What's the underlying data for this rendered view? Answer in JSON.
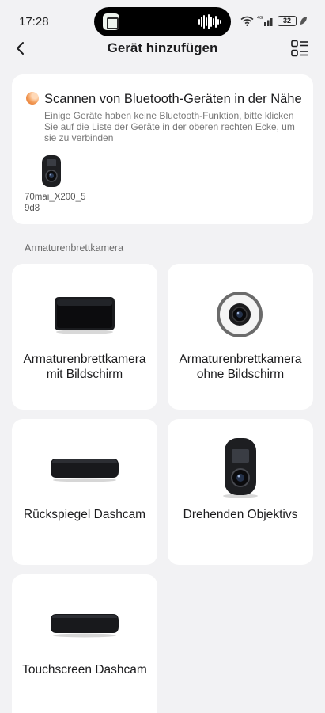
{
  "status_bar": {
    "time": "17:28",
    "battery": "32",
    "network": "4G"
  },
  "header": {
    "title": "Gerät hinzufügen"
  },
  "scan": {
    "title": "Scannen von Bluetooth-Geräten in der Nähe",
    "description": "Einige Geräte haben keine Bluetooth-Funktion, bitte klicken Sie auf die Liste der Geräte in der oberen rechten Ecke, um sie zu verbinden",
    "found_devices": [
      {
        "name": "70mai_X200_59d8",
        "icon": "dashcam-icon"
      }
    ]
  },
  "section": {
    "label": "Armaturenbrettkamera"
  },
  "device_types": [
    {
      "label": "Armaturenbrettkamera mit Bildschirm",
      "icon": "screen-dashcam-icon"
    },
    {
      "label": "Armaturenbrettkamera ohne Bildschirm",
      "icon": "lens-dashcam-icon"
    },
    {
      "label": "Rückspiegel Dashcam",
      "icon": "mirror-dashcam-icon"
    },
    {
      "label": "Drehenden Objektivs",
      "icon": "rotating-lens-dashcam-icon"
    },
    {
      "label": "Touchscreen Dashcam",
      "icon": "touchscreen-dashcam-icon"
    }
  ],
  "colors": {
    "background": "#f2f2f4",
    "card": "#ffffff",
    "accent": "#e36b20"
  }
}
